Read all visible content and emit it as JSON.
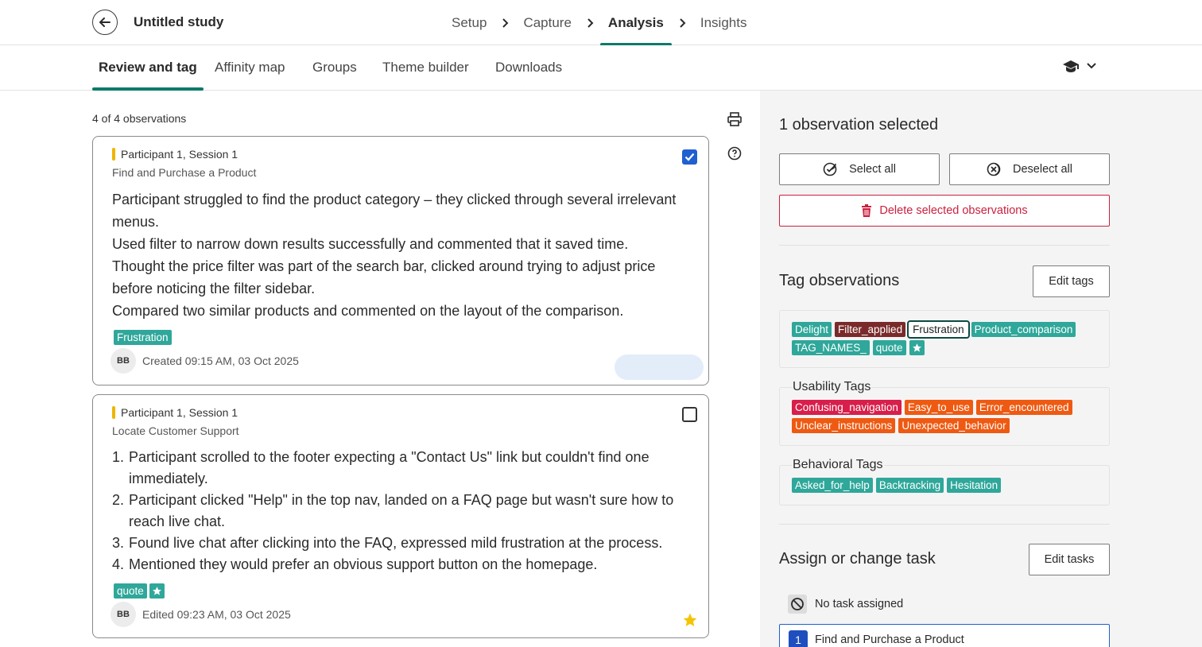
{
  "header": {
    "study_title": "Untitled study",
    "steps": [
      {
        "label": "Setup",
        "active": false
      },
      {
        "label": "Capture",
        "active": false
      },
      {
        "label": "Analysis",
        "active": true
      },
      {
        "label": "Insights",
        "active": false
      }
    ]
  },
  "tabs": [
    {
      "label": "Review and tag",
      "active": true
    },
    {
      "label": "Affinity map",
      "active": false
    },
    {
      "label": "Groups",
      "active": false
    },
    {
      "label": "Theme builder",
      "active": false
    },
    {
      "label": "Downloads",
      "active": false
    }
  ],
  "observation_count": "4 of 4 observations",
  "observations": [
    {
      "participant": "Participant 1, Session 1",
      "task": "Find and Purchase a Product",
      "checked": true,
      "lines": [
        "Participant struggled to find the product category – they clicked through several irrelevant menus.",
        "Used filter to narrow down results successfully and commented that it saved time.",
        "Thought the price filter was part of the search bar, clicked around trying to adjust price before noticing the filter sidebar.",
        "Compared two similar products and commented on the layout of the comparison."
      ],
      "tags": [
        {
          "label": "Frustration",
          "color": "#2fa79a"
        }
      ],
      "avatar": "BB",
      "meta": "Created 09:15 AM, 03 Oct 2025",
      "starred": false
    },
    {
      "participant": "Participant 1, Session 1",
      "task": "Locate Customer Support",
      "checked": false,
      "items": [
        {
          "num": "1.",
          "text": "Participant scrolled to the footer expecting a \"Contact Us\" link but couldn't find one immediately."
        },
        {
          "num": "2.",
          "text": "Participant clicked \"Help\" in the top nav, landed on a FAQ page but wasn't sure how to reach live chat."
        },
        {
          "num": "3.",
          "text": "Found live chat after clicking into the FAQ, expressed mild frustration at the process."
        },
        {
          "num": "4.",
          "text": "Mentioned they would prefer an obvious support button on the homepage."
        }
      ],
      "tags": [
        {
          "label": "quote",
          "color": "#2fa79a"
        }
      ],
      "star_tag_icon": "star-icon",
      "avatar": "BB",
      "meta": "Edited 09:23 AM, 03 Oct 2025",
      "starred": true
    }
  ],
  "panel": {
    "selected_title": "1 observation selected",
    "select_all": "Select all",
    "deselect_all": "Deselect all",
    "delete_selected": "Delete selected observations",
    "tag_title": "Tag observations",
    "edit_tags": "Edit tags",
    "general_tags": [
      {
        "label": "Delight",
        "color": "#2fa79a"
      },
      {
        "label": "Filter_applied",
        "color": "#7a2a2a"
      },
      {
        "label": "Frustration",
        "color": "#ffffff",
        "selected": true
      },
      {
        "label": "Product_comparison",
        "color": "#2fa79a"
      },
      {
        "label": "TAG_NAMES_",
        "color": "#2fa79a"
      },
      {
        "label": "quote",
        "color": "#2fa79a"
      }
    ],
    "usability_title": "Usability Tags",
    "usability_tags": [
      {
        "label": "Confusing_navigation",
        "color": "#d81e4a"
      },
      {
        "label": "Easy_to_use",
        "color": "#ee5a12"
      },
      {
        "label": "Error_encountered",
        "color": "#ee5a12"
      },
      {
        "label": "Unclear_instructions",
        "color": "#ee5a12"
      },
      {
        "label": "Unexpected_behavior",
        "color": "#ee5a12"
      }
    ],
    "behavioral_title": "Behavioral Tags",
    "behavioral_tags": [
      {
        "label": "Asked_for_help",
        "color": "#2fa79a"
      },
      {
        "label": "Backtracking",
        "color": "#2fa79a"
      },
      {
        "label": "Hesitation",
        "color": "#2fa79a"
      }
    ],
    "task_title": "Assign or change task",
    "edit_tasks": "Edit tasks",
    "no_task": "No task assigned",
    "task_option": {
      "num": "1",
      "label": "Find and Purchase a Product"
    }
  },
  "colors": {
    "accent": "#0f7a6b",
    "checkbox": "#1f5fd0",
    "danger": "#cc1f3f",
    "star": "#f5c400",
    "participant_bar": "#f0b400"
  }
}
